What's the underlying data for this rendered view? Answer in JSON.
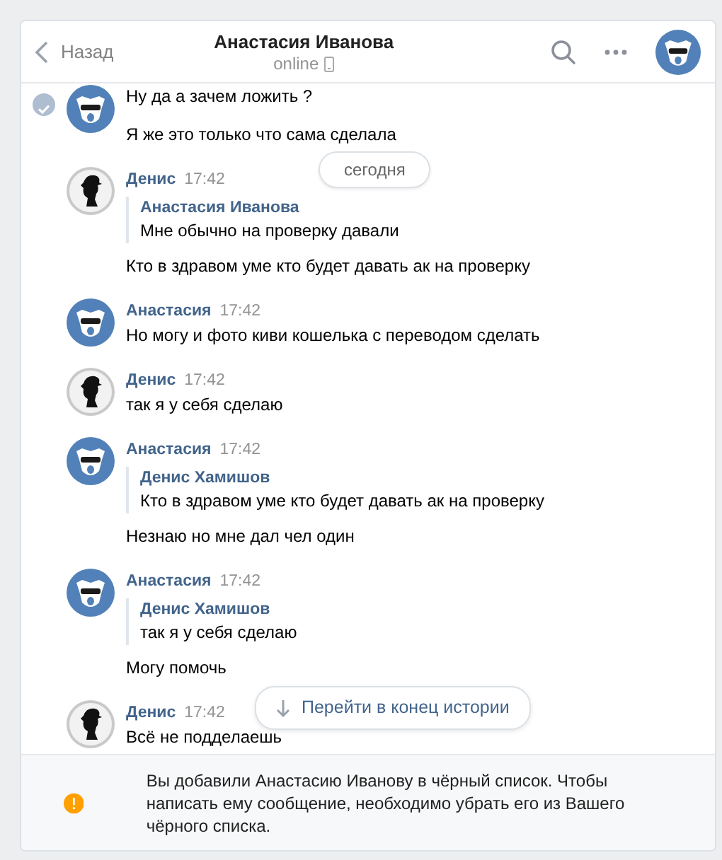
{
  "header": {
    "back_label": "Назад",
    "title": "Анастасия Иванова",
    "status": "online"
  },
  "date_pill": "сегодня",
  "messages": [
    {
      "kind": "bear",
      "selected": true,
      "items": [
        {
          "kind": "text",
          "text": "Ну да а зачем ложить ?"
        },
        {
          "kind": "text",
          "text": "Я же это только что сама сделала"
        }
      ]
    },
    {
      "author": "Денис",
      "time": "17:42",
      "kind": "silhouette",
      "selected": false,
      "items": [
        {
          "kind": "quote",
          "author": "Анастасия Иванова",
          "text": "Мне обычно на проверку давали"
        },
        {
          "kind": "text",
          "text": "Кто в здравом уме кто будет давать ак на проверку"
        }
      ]
    },
    {
      "author": "Анастасия",
      "time": "17:42",
      "kind": "bear",
      "selected": false,
      "items": [
        {
          "kind": "text",
          "text": "Но могу и фото киви кошелька с переводом сделать"
        }
      ]
    },
    {
      "author": "Денис",
      "time": "17:42",
      "kind": "silhouette",
      "selected": false,
      "items": [
        {
          "kind": "text",
          "text": "так я у себя сделаю"
        }
      ]
    },
    {
      "author": "Анастасия",
      "time": "17:42",
      "kind": "bear",
      "selected": false,
      "items": [
        {
          "kind": "quote",
          "author": "Денис Хамишов",
          "text": "Кто в здравом уме кто будет давать ак на проверку"
        },
        {
          "kind": "text",
          "text": "Незнаю но мне дал чел один"
        }
      ]
    },
    {
      "author": "Анастасия",
      "time": "17:42",
      "kind": "bear",
      "selected": false,
      "items": [
        {
          "kind": "quote",
          "author": "Денис Хамишов",
          "text": "так я у себя сделаю"
        },
        {
          "kind": "text",
          "text": "Могу помочь"
        }
      ]
    },
    {
      "author": "Денис",
      "time": "17:42",
      "kind": "silhouette",
      "selected": false,
      "items": [
        {
          "kind": "text",
          "text": "Всё не подделаешь"
        }
      ]
    }
  ],
  "jump_button": "Перейти в конец истории",
  "notice": "Вы добавили Анастасию Иванову в чёрный список. Чтобы написать ему сообщение, необходимо убрать его из Вашего чёрного списка."
}
